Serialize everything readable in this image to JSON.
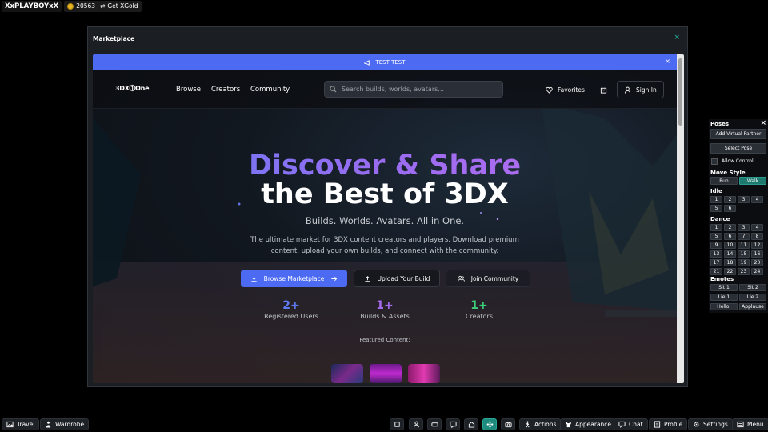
{
  "user": {
    "name": "XxPLAYBOYxX",
    "gold": "20563",
    "get_gold": "Get XGold"
  },
  "window": {
    "title": "Marketplace",
    "close": "×"
  },
  "banner": {
    "text": "TEST TEST",
    "close": "×"
  },
  "nav": {
    "logo": "3DX⓵One",
    "links": [
      "Browse",
      "Creators",
      "Community"
    ],
    "search_placeholder": "Search builds, worlds, avatars...",
    "favorites": "Favorites",
    "sign_in": "Sign In"
  },
  "hero": {
    "line1": "Discover & Share",
    "line2": "the Best of 3DX",
    "tagline": "Builds. Worlds. Avatars. All in One.",
    "description": "The ultimate market for 3DX content creators and players. Download premium content, upload your own builds, and connect with the community."
  },
  "actions": {
    "browse": "Browse Marketplace",
    "upload": "Upload Your Build",
    "join": "Join Community"
  },
  "stats": [
    {
      "num": "2+",
      "label": "Registered Users",
      "color": "#5f7cf5"
    },
    {
      "num": "1+",
      "label": "Builds & Assets",
      "color": "#a56cf0"
    },
    {
      "num": "1+",
      "label": "Creators",
      "color": "#3ccf7a"
    }
  ],
  "featured_label": "Featured Content:",
  "poses": {
    "title": "Poses",
    "close": "×",
    "add_partner": "Add Virtual Partner",
    "select_pose": "Select Pose",
    "allow_control": "Allow Control",
    "move_style_title": "Move Style",
    "run": "Run",
    "walk": "Walk",
    "idle_title": "Idle",
    "idle": [
      "1",
      "2",
      "3",
      "4",
      "5",
      "6"
    ],
    "dance_title": "Dance",
    "dance": [
      "1",
      "2",
      "3",
      "4",
      "5",
      "6",
      "7",
      "8",
      "9",
      "10",
      "11",
      "12",
      "13",
      "14",
      "15",
      "16",
      "17",
      "18",
      "19",
      "20",
      "21",
      "22",
      "23",
      "24"
    ],
    "emotes_title": "Emotes",
    "emotes": [
      "Sit 1",
      "Sit 2",
      "Lie 1",
      "Lie 2",
      "Hello!",
      "Applause"
    ]
  },
  "bottombar": {
    "travel": "Travel",
    "wardrobe": "Wardrobe",
    "actions": "Actions",
    "appearance": "Appearance",
    "chat": "Chat",
    "profile": "Profile",
    "settings": "Settings",
    "menu": "Menu"
  },
  "colors": {
    "accent": "#4d6bf2",
    "teal": "#1d8a7d",
    "panel": "#1b1e22"
  }
}
